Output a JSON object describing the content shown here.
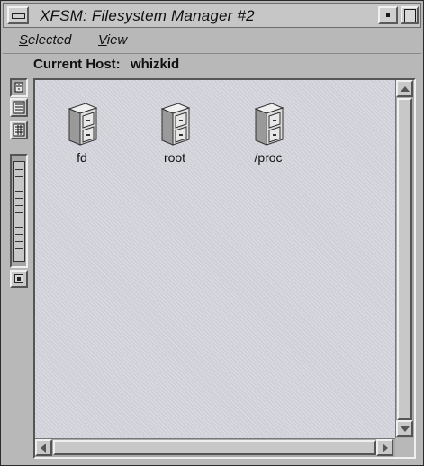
{
  "window": {
    "title": "XFSM: Filesystem Manager #2"
  },
  "menu": [
    {
      "mnemonic": "S",
      "rest": "elected"
    },
    {
      "mnemonic": "V",
      "rest": "iew"
    }
  ],
  "host": {
    "label": "Current Host:",
    "value": "whizkid"
  },
  "toolbar": {
    "buttons": [
      "icon-view-icon",
      "list-view-icon",
      "detail-view-icon"
    ],
    "zoom_icon": "zoom-slider",
    "toggle_icon": "square-toggle-icon"
  },
  "filesystems": [
    {
      "label": "fd",
      "icon": "file-cabinet-icon"
    },
    {
      "label": "root",
      "icon": "file-cabinet-icon"
    },
    {
      "label": "/proc",
      "icon": "file-cabinet-icon"
    }
  ],
  "colors": {
    "chrome": "#b8b8b8",
    "canvas": "#cfcfd8",
    "text": "#101010"
  }
}
